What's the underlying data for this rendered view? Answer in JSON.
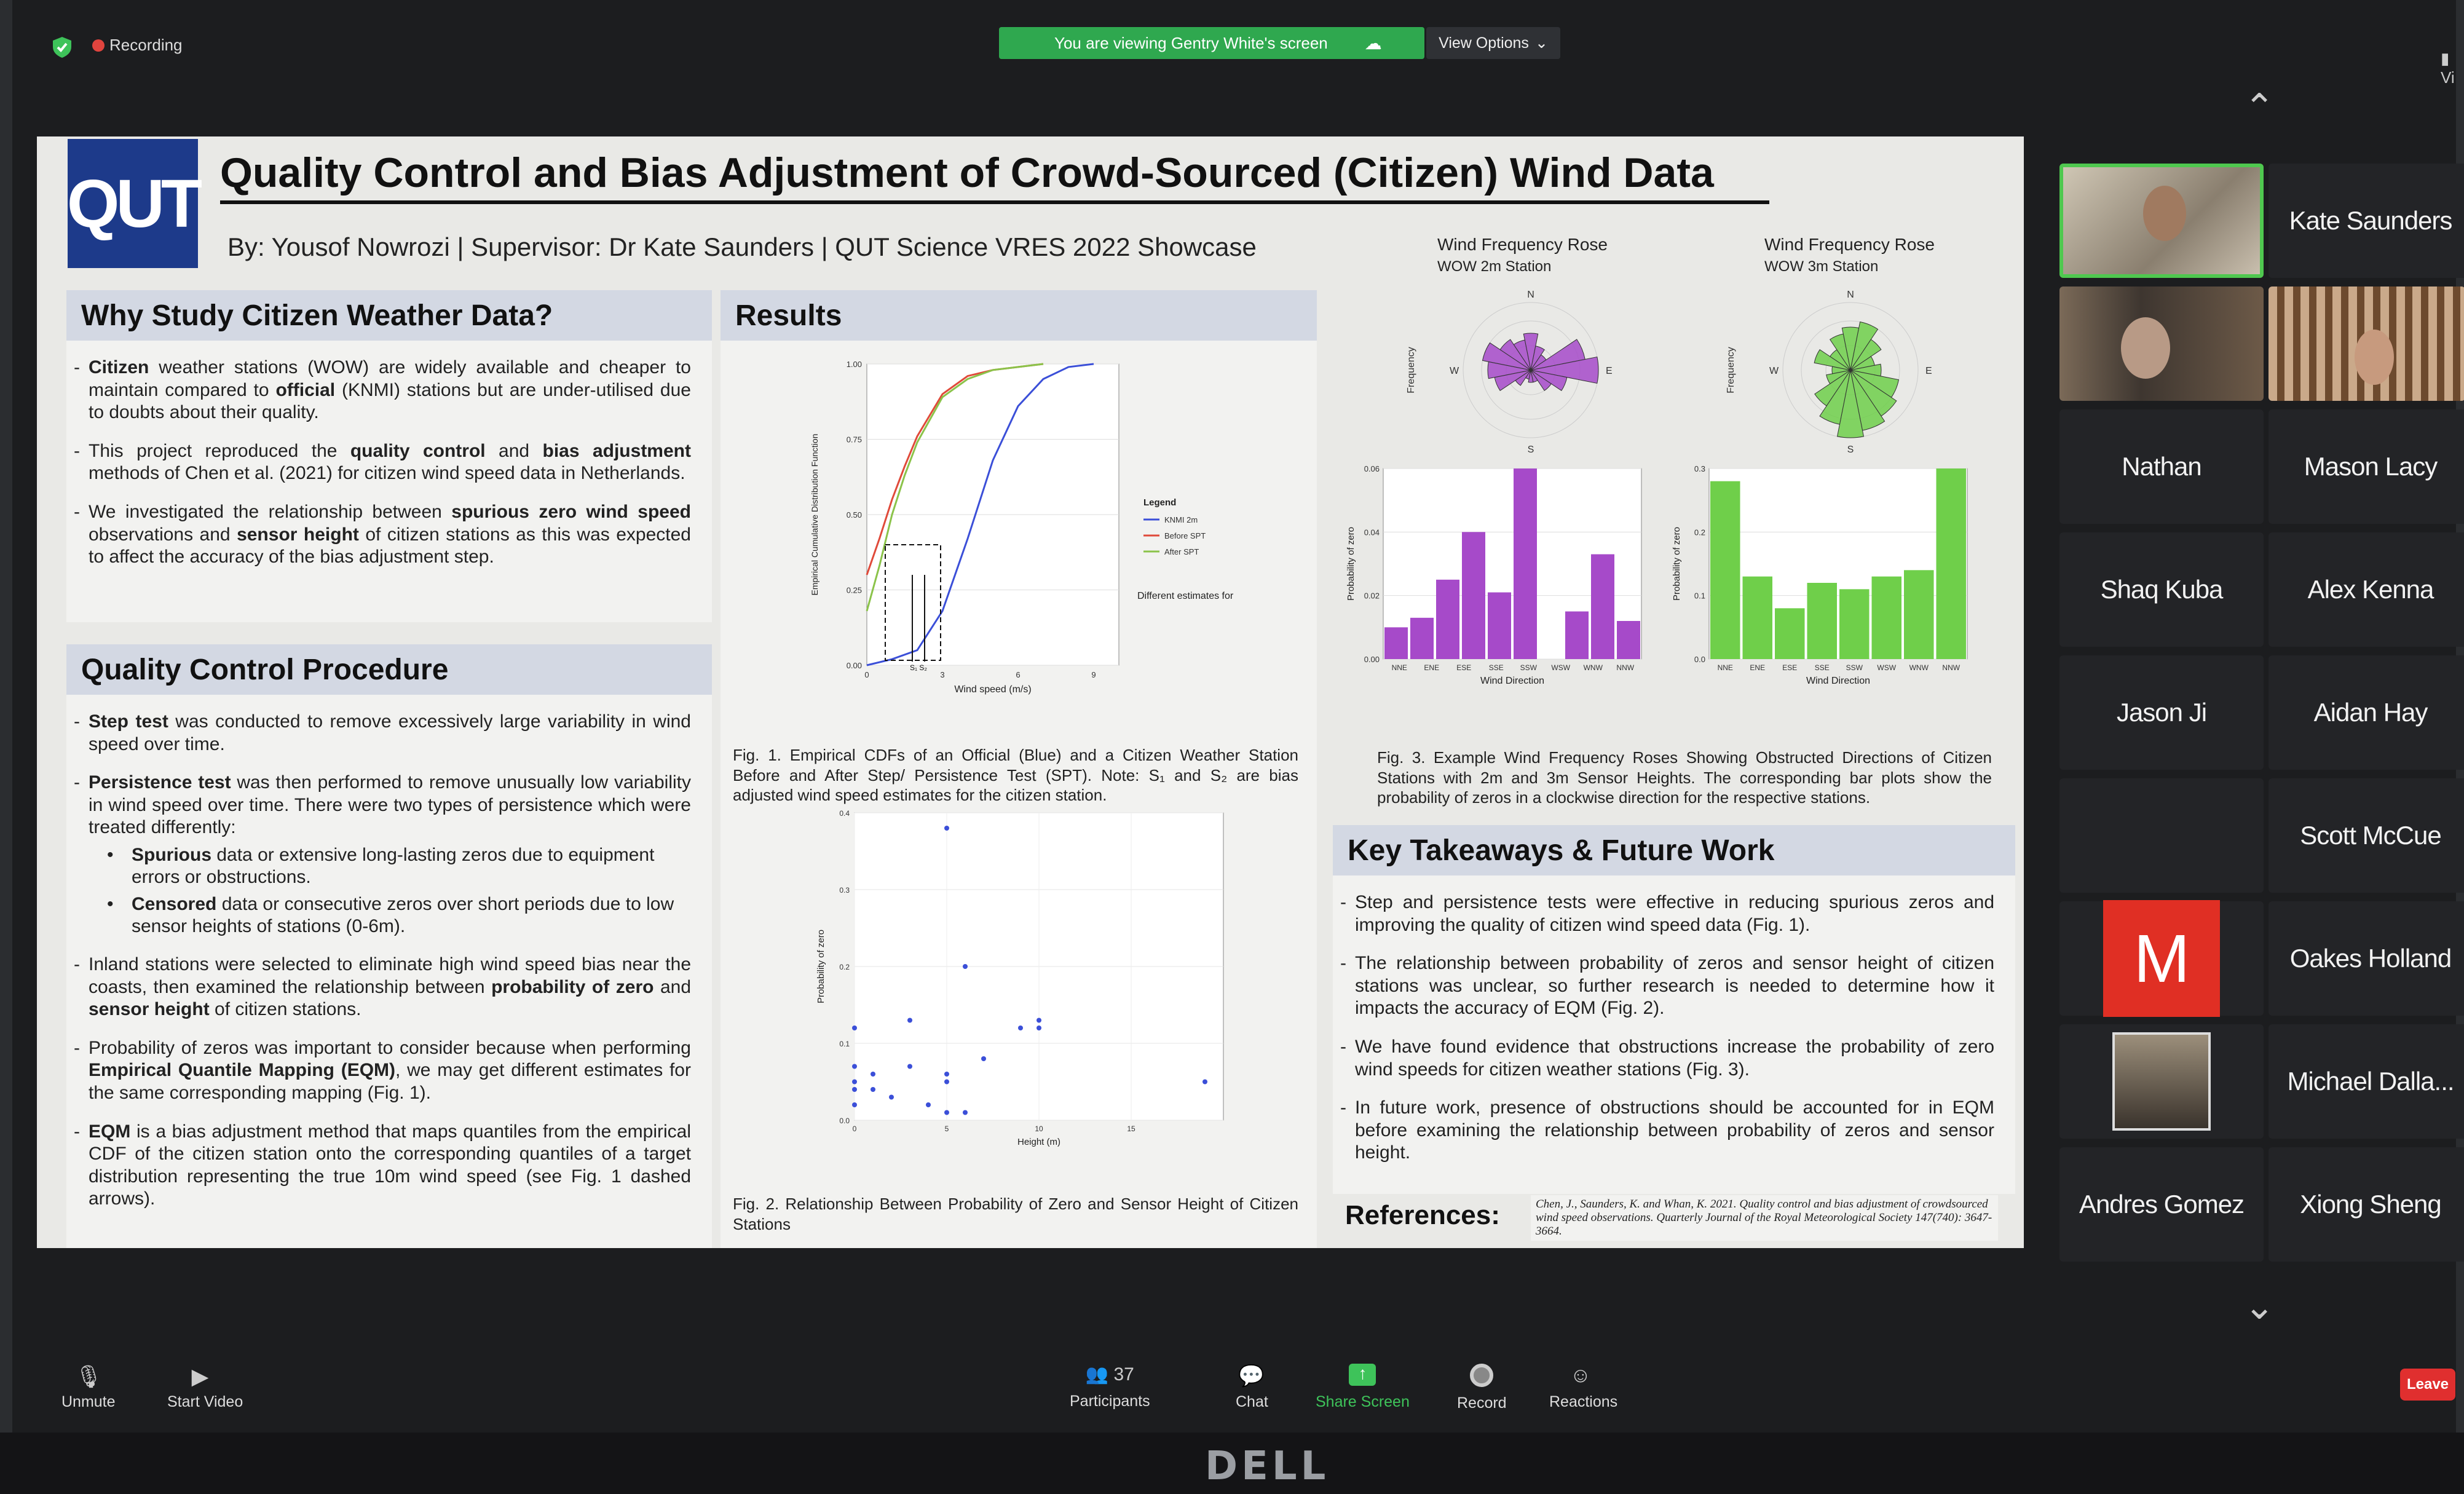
{
  "meeting": {
    "recording_label": "Recording",
    "banner_text": "You are viewing Gentry White's screen",
    "view_options_label": "View Options",
    "top_right_label": "Vi",
    "monitor_brand": "DELL"
  },
  "poster": {
    "logo_text": "QUT",
    "title": "Quality Control and Bias Adjustment of Crowd-Sourced (Citizen) Wind Data",
    "byline": "By: Yousof Nowrozi | Supervisor: Dr Kate Saunders | QUT Science VRES 2022 Showcase",
    "why": {
      "heading": "Why Study Citizen Weather Data?",
      "b1": "Citizen weather stations (WOW) are widely available and cheaper to maintain compared to official (KNMI) stations but are under-utilised due to doubts about their quality.",
      "b2": "This project reproduced the quality control and bias adjustment methods of Chen et al. (2021) for citizen wind speed data in Netherlands.",
      "b3": "We investigated the relationship between spurious zero wind speed observations and sensor height of citizen stations as this was expected to affect the accuracy of the bias adjustment step."
    },
    "qc": {
      "heading": "Quality Control Procedure",
      "b1": "Step test was conducted to remove excessively large variability in wind speed over time.",
      "b2": "Persistence test was then performed to remove unusually low variability in wind speed over time. There were two types of persistence which were treated differently:",
      "s1": "Spurious data or extensive long-lasting zeros due to equipment errors or obstructions.",
      "s2": "Censored data or consecutive zeros over short periods due to low sensor heights of stations (0-6m).",
      "b3": "Inland stations were selected to eliminate high wind speed bias near the coasts, then examined the relationship between probability of zero and sensor height of citizen stations.",
      "b4": "Probability of zeros was important to consider because when performing Empirical Quantile Mapping (EQM), we may get different estimates for the same corresponding mapping (Fig. 1).",
      "b5": "EQM is a bias adjustment method that maps quantiles from the empirical CDF of the citizen station onto the corresponding quantiles of a target distribution representing the true 10m wind speed (see Fig. 1 dashed arrows)."
    },
    "results_heading": "Results",
    "fig1": {
      "ylabel": "Empirical Cumulative Distribution Function",
      "xlabel": "Wind speed (m/s)",
      "legend_title": "Legend",
      "legend": [
        "KNMI 2m",
        "Before SPT",
        "After SPT"
      ],
      "annotation": "Different estimates for the same mapping",
      "s_labels": "S₁ S₂",
      "caption": "Fig. 1. Empirical CDFs of an Official (Blue) and a Citizen Weather Station Before and After Step/ Persistence Test (SPT). Note: S₁ and S₂ are bias adjusted wind speed estimates for the citizen station."
    },
    "fig2": {
      "ylabel": "Probability of zero",
      "xlabel": "Height (m)",
      "caption": "Fig. 2. Relationship Between Probability of Zero and Sensor Height of Citizen Stations"
    },
    "fig3": {
      "rose1_title": "Wind Frequency Rose",
      "rose1_sub": "WOW 2m Station",
      "rose2_title": "Wind Frequency Rose",
      "rose2_sub": "WOW 3m Station",
      "freq_label": "Frequency",
      "prob_label": "Probability of zero",
      "dir_label": "Wind Direction",
      "n": "N",
      "s": "S",
      "e": "E",
      "w": "W",
      "caption": "Fig. 3. Example Wind Frequency Roses Showing Obstructed Directions of Citizen Stations with 2m and 3m Sensor Heights. The corresponding bar plots show the probability of zeros in a clockwise direction for the respective stations."
    },
    "takeaways": {
      "heading": "Key Takeaways & Future Work",
      "b1": "Step and persistence tests were effective in reducing spurious zeros and improving the quality of citizen wind speed data (Fig. 1).",
      "b2": "The relationship between probability of zeros and sensor height of citizen stations was unclear, so further research is needed to determine how it impacts the accuracy of EQM (Fig. 2).",
      "b3": "We have found evidence that obstructions increase the probability of zero wind speeds for citizen weather stations (Fig. 3).",
      "b4": "In future work, presence of obstructions should be accounted for in EQM before examining the relationship between probability of zeros and sensor height."
    },
    "references_label": "References:",
    "references_text": "Chen, J., Saunders, K. and Whan, K. 2021. Quality control and bias adjustment of crowdsourced wind speed observations. Quarterly Journal of the Royal Meteorological Society 147(740): 3647-3664."
  },
  "chart_data": [
    {
      "type": "line",
      "title": "",
      "xlabel": "Wind speed (m/s)",
      "ylabel": "Empirical Cumulative Distribution Function",
      "ylim": [
        0,
        1
      ],
      "yticks": [
        "0.00",
        "0.25",
        "0.50",
        "0.75",
        "1.00"
      ],
      "xticks": [
        "0",
        "3",
        "6",
        "9"
      ],
      "series": [
        {
          "name": "KNMI 2m",
          "color": "#3b4fd8",
          "x": [
            0,
            1,
            2,
            3,
            4,
            5,
            6,
            7,
            8,
            9
          ],
          "y": [
            0,
            0.02,
            0.05,
            0.18,
            0.42,
            0.68,
            0.86,
            0.95,
            0.99,
            1.0
          ]
        },
        {
          "name": "Before SPT",
          "color": "#e04a3a",
          "x": [
            0,
            0.5,
            1,
            1.5,
            2,
            3,
            4,
            5,
            6,
            7
          ],
          "y": [
            0.3,
            0.42,
            0.55,
            0.66,
            0.76,
            0.9,
            0.96,
            0.98,
            0.99,
            1.0
          ]
        },
        {
          "name": "After SPT",
          "color": "#8bc34a",
          "x": [
            0,
            0.5,
            1,
            1.5,
            2,
            3,
            4,
            5,
            6,
            7
          ],
          "y": [
            0.18,
            0.33,
            0.5,
            0.63,
            0.74,
            0.89,
            0.95,
            0.98,
            0.99,
            1.0
          ]
        }
      ]
    },
    {
      "type": "scatter",
      "title": "",
      "xlabel": "Height (m)",
      "ylabel": "Probability of zero",
      "ylim": [
        0,
        0.4
      ],
      "yticks": [
        "0.0",
        "0.1",
        "0.2",
        "0.3",
        "0.4"
      ],
      "xticks": [
        "0",
        "5",
        "10",
        "15"
      ],
      "points": [
        [
          0,
          0.12
        ],
        [
          0,
          0.07
        ],
        [
          0,
          0.05
        ],
        [
          0,
          0.04
        ],
        [
          0,
          0.02
        ],
        [
          1,
          0.06
        ],
        [
          1,
          0.04
        ],
        [
          2,
          0.03
        ],
        [
          3,
          0.13
        ],
        [
          3,
          0.07
        ],
        [
          4,
          0.02
        ],
        [
          5,
          0.01
        ],
        [
          5,
          0.06
        ],
        [
          5,
          0.05
        ],
        [
          5,
          0.38
        ],
        [
          6,
          0.2
        ],
        [
          6,
          0.01
        ],
        [
          7,
          0.08
        ],
        [
          9,
          0.12
        ],
        [
          10,
          0.12
        ],
        [
          10,
          0.13
        ],
        [
          19,
          0.05
        ]
      ]
    },
    {
      "type": "bar",
      "title": "",
      "xlabel": "Wind Direction",
      "ylabel": "Probability of zero",
      "ylim": [
        0,
        0.06
      ],
      "yticks": [
        "0.00",
        "0.02",
        "0.04",
        "0.06"
      ],
      "categories": [
        "NNE",
        "ENE",
        "ESE",
        "SSE",
        "SSW",
        "WSW",
        "WNW",
        "NNW"
      ],
      "values": [
        0.01,
        0.013,
        0.025,
        0.04,
        0.021,
        0.063,
        0.0,
        0.015,
        0.033,
        0.012
      ],
      "bar_count": 10,
      "color": "#a64ac9",
      "arrow_color": "#d32f2f"
    },
    {
      "type": "bar",
      "title": "",
      "xlabel": "Wind Direction",
      "ylabel": "Probability of zero",
      "ylim": [
        0,
        0.3
      ],
      "yticks": [
        "0.0",
        "0.1",
        "0.2",
        "0.3"
      ],
      "categories": [
        "NNE",
        "ENE",
        "ESE",
        "SSE",
        "SSW",
        "WSW",
        "WNW",
        "NNW"
      ],
      "values": [
        0.28,
        0.13,
        0.08,
        0.12,
        0.11,
        0.13,
        0.14,
        0.33
      ],
      "color": "#6fcf4a",
      "arrow_color": "#d32f2f"
    }
  ],
  "participants": {
    "tiles": [
      "Kate Saunders",
      "Nathan",
      "Mason Lacy",
      "Shaq Kuba",
      "Alex Kenna",
      "Jason Ji",
      "Aidan Hay",
      "Scott McCue",
      "Oakes Holland",
      "Michael Dalla...",
      "Andres Gomez",
      "Xiong Sheng"
    ],
    "avatar_letter": "M",
    "avatar_color": "#e02f24"
  },
  "toolbar": {
    "unmute": "Unmute",
    "start_video": "Start Video",
    "participants": "Participants",
    "participants_count": "37",
    "chat": "Chat",
    "share_screen": "Share Screen",
    "record": "Record",
    "reactions": "Reactions",
    "leave": "Leave"
  }
}
